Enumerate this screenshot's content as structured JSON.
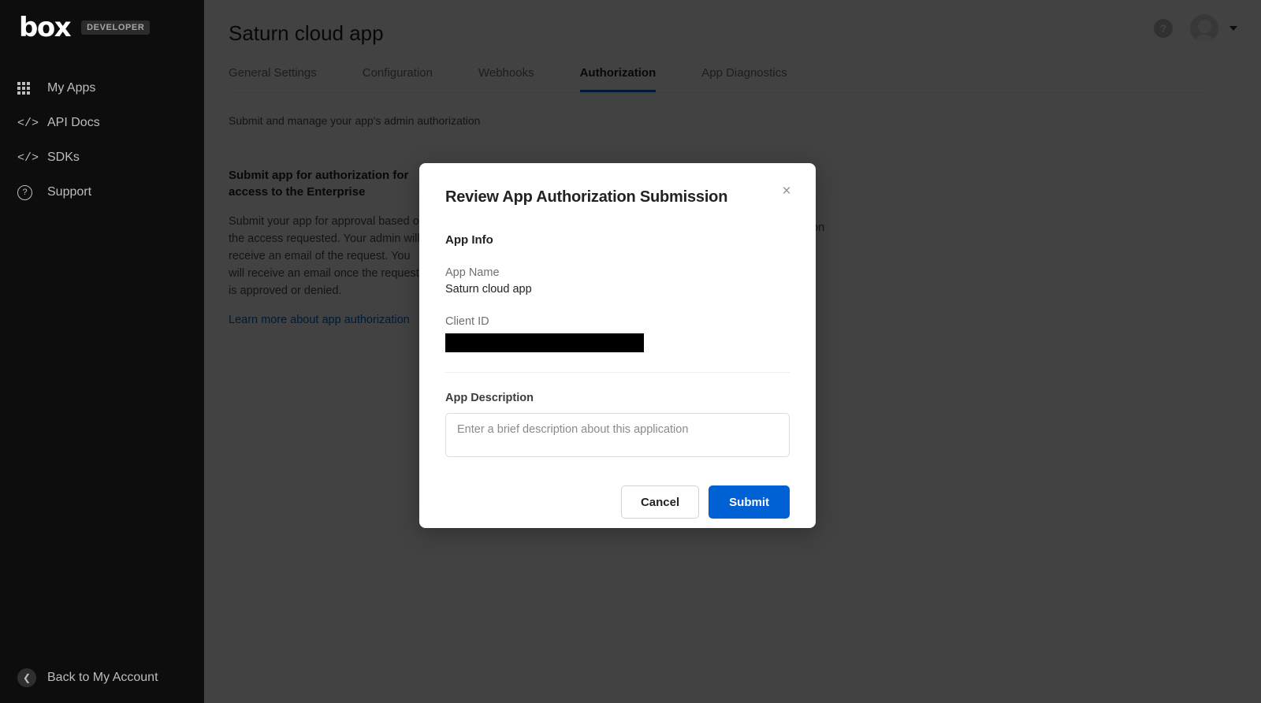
{
  "sidebar": {
    "logo_text": "box",
    "logo_badge": "DEVELOPER",
    "items": [
      {
        "label": "My Apps",
        "icon": "grid-icon"
      },
      {
        "label": "API Docs",
        "icon": "code-icon"
      },
      {
        "label": "SDKs",
        "icon": "code-icon"
      },
      {
        "label": "Support",
        "icon": "question-circle-icon"
      }
    ],
    "back_label": "Back to My Account",
    "back_icon": "chevron-left-circle-icon",
    "background": "#0d0d0d"
  },
  "topbar": {
    "help_icon_glyph": "?",
    "help_icon_name": "help-circle-icon",
    "avatar_name": "user-avatar",
    "caret_name": "chevron-down-icon"
  },
  "header": {
    "page_title": "Saturn cloud app",
    "subtitle": "Submit and manage your app's admin authorization"
  },
  "tabs": [
    {
      "label": "General Settings",
      "active": false
    },
    {
      "label": "Configuration",
      "active": false
    },
    {
      "label": "Webhooks",
      "active": false
    },
    {
      "label": "Authorization",
      "active": true
    },
    {
      "label": "App Diagnostics",
      "active": false
    }
  ],
  "panel": {
    "heading": "Submit app for authorization for access to the Enterprise",
    "body": "Submit your app for approval based on the access requested. Your admin will receive an email of the request. You will receive an email once the request is approved or denied.",
    "link": "Learn more about app authorization",
    "trailing_fragment": "on"
  },
  "modal": {
    "title": "Review App Authorization Submission",
    "close_glyph": "×",
    "close_icon": "close-icon",
    "section_title": "App Info",
    "app_name_label": "App Name",
    "app_name_value": "Saturn cloud app",
    "client_id_label": "Client ID",
    "client_id_value": "",
    "client_id_redacted": true,
    "description_label": "App Description",
    "description_value": "",
    "description_placeholder": "Enter a brief description about this application",
    "cancel_label": "Cancel",
    "submit_label": "Submit"
  },
  "colors": {
    "brand_blue": "#0061d5",
    "sidebar_bg": "#0d0d0d",
    "overlay": "rgba(0,0,0,0.74)",
    "link": "#0061d5",
    "redaction": "#000000"
  }
}
